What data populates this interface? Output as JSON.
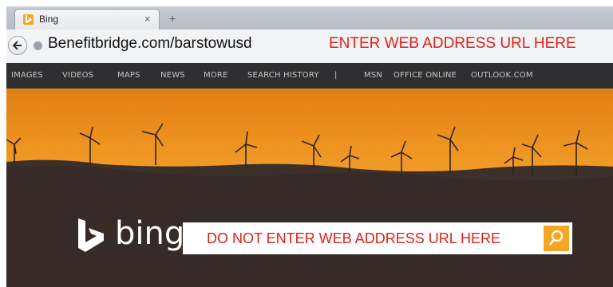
{
  "tab": {
    "title": "Bing",
    "close_glyph": "×",
    "new_tab_glyph": "+"
  },
  "toolbar": {
    "url": "Benefitbridge.com/barstowusd",
    "url_note": "ENTER WEB ADDRESS URL HERE"
  },
  "nav": {
    "items": [
      "IMAGES",
      "VIDEOS",
      "MAPS",
      "NEWS",
      "MORE",
      "SEARCH HISTORY",
      "|",
      "MSN",
      "OFFICE ONLINE",
      "OUTLOOK.COM"
    ]
  },
  "hero": {
    "brand": "bing",
    "search_text": "DO NOT ENTER WEB ADDRESS URL HERE"
  },
  "colors": {
    "accent": "#f5a623",
    "warning_text": "#e0201b",
    "nav_bg": "#2f2f31"
  },
  "icons": [
    "bing-favicon-icon",
    "close-icon",
    "new-tab-icon",
    "back-arrow-icon",
    "globe-icon",
    "bing-logo-icon",
    "search-icon"
  ]
}
